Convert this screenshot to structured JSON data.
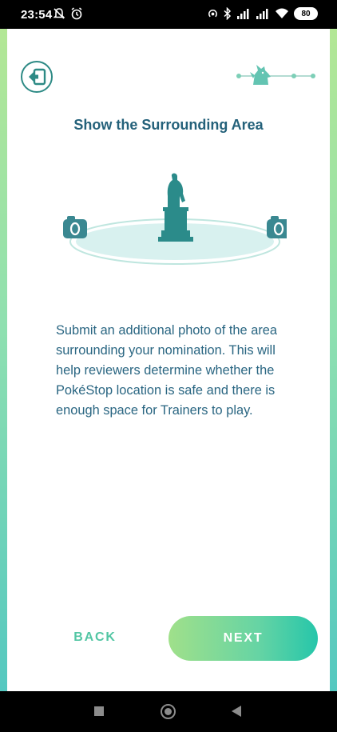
{
  "status_bar": {
    "time": "23:54",
    "battery": "80",
    "left_icons": [
      "muted-notification-icon",
      "alarm-icon"
    ],
    "right_icons": [
      "hotspot-icon",
      "bluetooth-icon",
      "signal-icon",
      "signal-icon",
      "wifi-icon",
      "battery-icon"
    ]
  },
  "header": {
    "exit_icon": "exit-icon",
    "progress_steps": 4,
    "progress_current_step": 2,
    "progress_icon": "pikachu-icon"
  },
  "screen": {
    "title": "Show the Surrounding Area",
    "description": "Submit an additional photo of the area surrounding your nomination. This will help reviewers determine whether the PokéStop location is safe and there is enough space for Trainers to play."
  },
  "footer": {
    "back_label": "BACK",
    "next_label": "NEXT"
  },
  "navigation_bar": {
    "items": [
      "recents-button",
      "home-button",
      "back-button"
    ]
  },
  "colors": {
    "title": "#24617a",
    "text": "#2a6682",
    "accent_teal": "#2d8a85",
    "back_text": "#53c6a4",
    "next_gradient_start": "#a0e08a",
    "next_gradient_end": "#26c6aa"
  }
}
